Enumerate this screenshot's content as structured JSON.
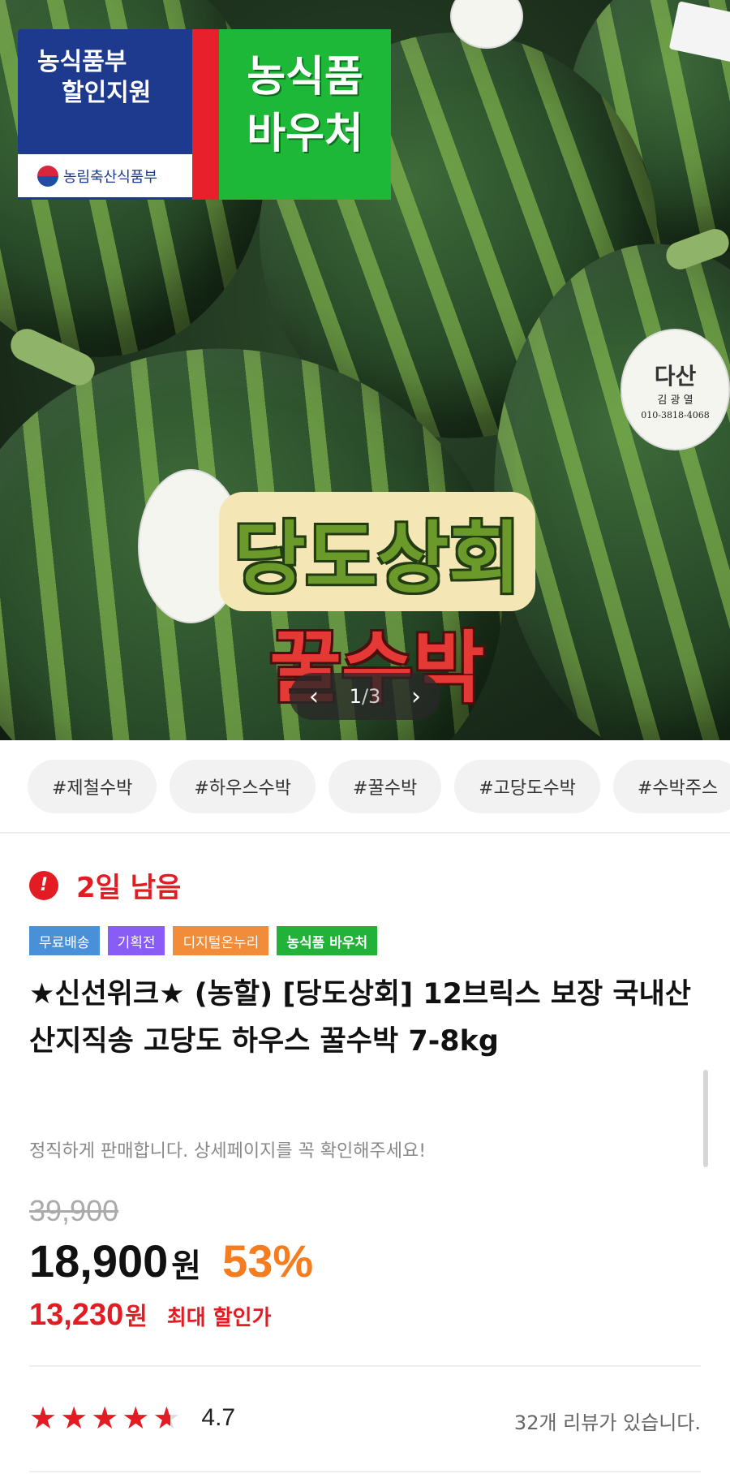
{
  "hero": {
    "badge_ministry_line1": "농식품부",
    "badge_ministry_line2": "할인지원",
    "badge_ministry_footer": "농림축산식품부",
    "badge_voucher_line1": "농식품",
    "badge_voucher_line2": "바우처",
    "overlay_line1": "당도상회",
    "overlay_line2": "꿀수박",
    "sticker_brand": "다산",
    "sticker_name": "김 광 열",
    "sticker_phone": "010-3818-4068",
    "pager": {
      "current": "1",
      "separator": "/",
      "total": "3",
      "prev_icon": "chevron-left-icon",
      "next_icon": "chevron-right-icon"
    }
  },
  "tags": [
    "#제철수박",
    "#하우스수박",
    "#꿀수박",
    "#고당도수박",
    "#수박주스"
  ],
  "countdown": {
    "icon": "!",
    "text": "2일 남음"
  },
  "badges": [
    {
      "label": "무료배송",
      "color": "#4a90d9"
    },
    {
      "label": "기획전",
      "color": "#8a5cf6"
    },
    {
      "label": "디지털온누리",
      "color": "#f08c3a"
    },
    {
      "label": "농식품 바우처",
      "color": "#22b23a"
    }
  ],
  "product": {
    "title": "★신선위크★ (농할) [당도상회] 12브릭스 보장 국내산 산지직송 고당도 하우스 꿀수박 7-8kg",
    "subtitle": "정직하게 판매합니다. 상세페이지를 꼭 확인해주세요!"
  },
  "price": {
    "original": "39,900",
    "current": "18,900",
    "unit": "원",
    "discount": "53%",
    "max_discount_price": "13,230",
    "max_discount_unit": "원",
    "max_discount_label": "최대 할인가"
  },
  "rating": {
    "value": 4.7,
    "value_text": "4.7",
    "review_text": "32개 리뷰가 있습니다."
  },
  "colors": {
    "accent_red": "#e31c23",
    "discount_orange": "#f57c1f"
  }
}
